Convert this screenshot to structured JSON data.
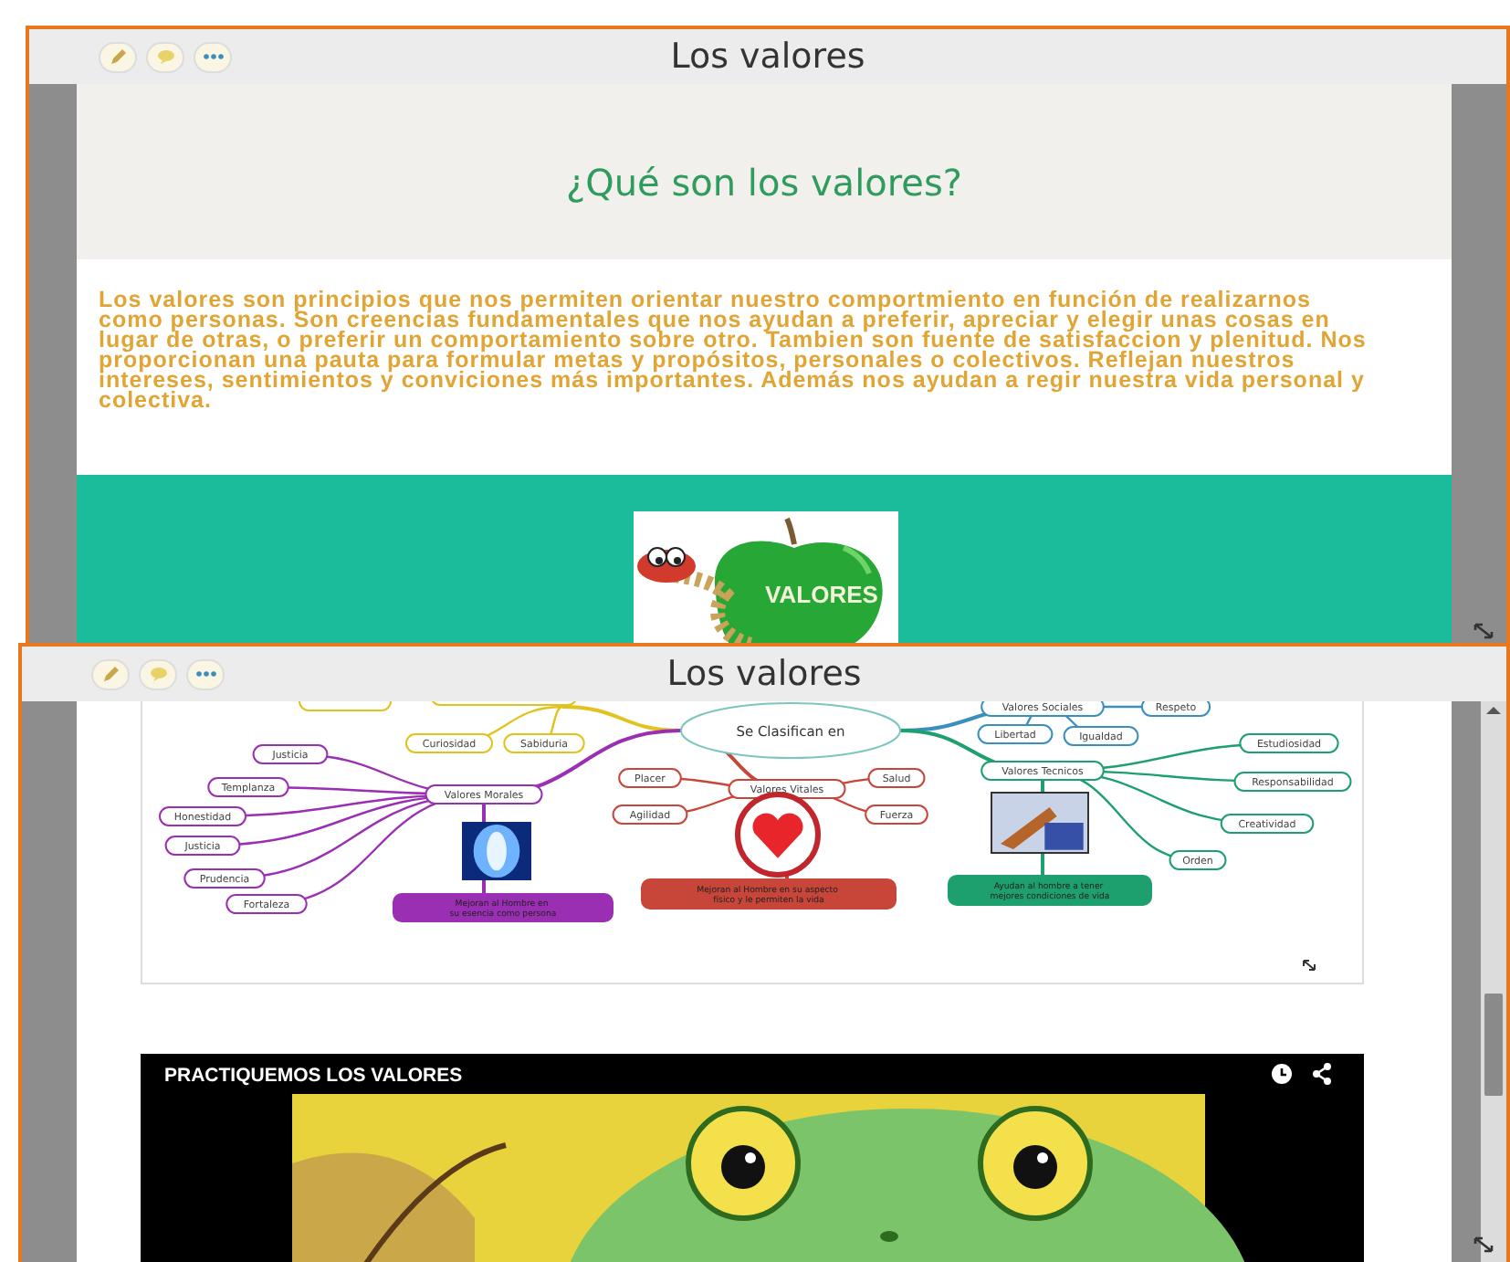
{
  "windows": [
    {
      "title": "Los valores",
      "heading": "¿Qué son los valores?",
      "paragraph": "Los valores son principios que nos permiten orientar nuestro comportmiento en función de realizarnos como personas. Son creencias fundamentales que nos ayudan a preferir, apreciar y elegir unas cosas en lugar de otras, o preferir un comportamiento sobre otro. Tambien son fuente de satisfaccion y plenitud. Nos proporcionan una pauta para formular metas y propósitos, personales o colectivos. Reflejan nuestros intereses, sentimientos y conviciones más importantes. Además nos ayudan a regir nuestra vida personal y colectiva.",
      "logo_text": "VALORES"
    },
    {
      "title": "Los valores",
      "mind_map": {
        "center": "Se Clasifican en",
        "branches": [
          {
            "color": "#e2c21e",
            "nodes": [
              "Curiosidad",
              "Sabiduria"
            ]
          },
          {
            "label": "Valores Morales",
            "color": "#9a2fb3",
            "nodes": [
              "Justicia",
              "Templanza",
              "Honestidad",
              "Justicia",
              "Prudencia",
              "Fortaleza"
            ],
            "note": "Mejoran al Hombre en su esencia como persona"
          },
          {
            "label": "Valores Vitales",
            "color": "#c8453a",
            "nodes": [
              "Placer",
              "Salud",
              "Agilidad",
              "Fuerza"
            ],
            "note": "Mejoran al Hombre en su aspecto físico y le permiten la vida"
          },
          {
            "label": "Valores Sociales",
            "color": "#3b8fbf",
            "nodes": [
              "Respeto",
              "Libertad",
              "Igualdad"
            ]
          },
          {
            "label": "Valores Tecnicos",
            "color": "#1d9f6e",
            "nodes": [
              "Estudiosidad",
              "Responsabilidad",
              "Creatividad",
              "Orden"
            ],
            "note": "Ayudan al hombre a tener mejores condiciones de vida"
          }
        ]
      },
      "video": {
        "title": "PRACTIQUEMOS LOS VALORES"
      }
    }
  ]
}
